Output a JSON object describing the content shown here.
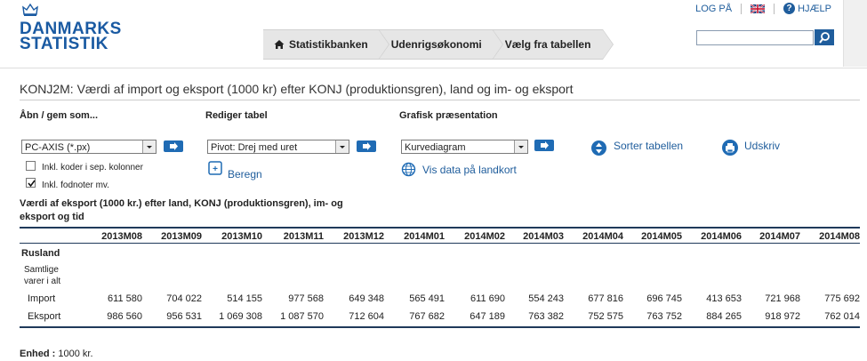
{
  "logo": {
    "line1": "DANMARKS",
    "line2": "STATISTIK"
  },
  "top_links": {
    "login": "LOG PÅ",
    "help": "HJÆLP"
  },
  "breadcrumb": [
    "Statistikbanken",
    "Udenrigsøkonomi",
    "Vælg fra tabellen"
  ],
  "title": "KONJ2M: Værdi af import og eksport (1000 kr) efter KONJ (produktionsgren), land og im- og eksport",
  "open_save": {
    "heading": "Åbn / gem som...",
    "format": "PC-AXIS (*.px)",
    "chk1": "Inkl. koder i sep. kolonner",
    "chk2": "Inkl. fodnoter mv.",
    "chk1_checked": false,
    "chk2_checked": true
  },
  "edit_table": {
    "heading": "Rediger tabel",
    "pivot": "Pivot: Drej med uret",
    "calc": "Beregn"
  },
  "graphic": {
    "heading": "Grafisk præsentation",
    "chart_type": "Kurvediagram",
    "map_link": "Vis data på landkort"
  },
  "sort_link": "Sorter tabellen",
  "print_link": "Udskriv",
  "table": {
    "caption_line1": "Værdi af eksport (1000 kr.) efter land, KONJ (produktionsgren), im- og",
    "caption_line2": "eksport og tid",
    "columns": [
      "2013M08",
      "2013M09",
      "2013M10",
      "2013M11",
      "2013M12",
      "2014M01",
      "2014M02",
      "2014M03",
      "2014M04",
      "2014M05",
      "2014M06",
      "2014M07",
      "2014M08"
    ],
    "group": "Rusland",
    "subgroup_line1": "Samtlige",
    "subgroup_line2": "varer i alt",
    "rows": [
      {
        "label": "Import",
        "values": [
          "611 580",
          "704 022",
          "514 155",
          "977 568",
          "649 348",
          "565 491",
          "611 690",
          "554 243",
          "677 816",
          "696 745",
          "413 653",
          "721 968",
          "775 692"
        ]
      },
      {
        "label": "Eksport",
        "values": [
          "986 560",
          "956 531",
          "1 069 308",
          "1 087 570",
          "712 604",
          "767 682",
          "647 189",
          "763 382",
          "752 575",
          "763 752",
          "884 265",
          "918 972",
          "762 014"
        ]
      }
    ]
  },
  "unit": {
    "label": "Enhed :",
    "value": "1000 kr."
  }
}
